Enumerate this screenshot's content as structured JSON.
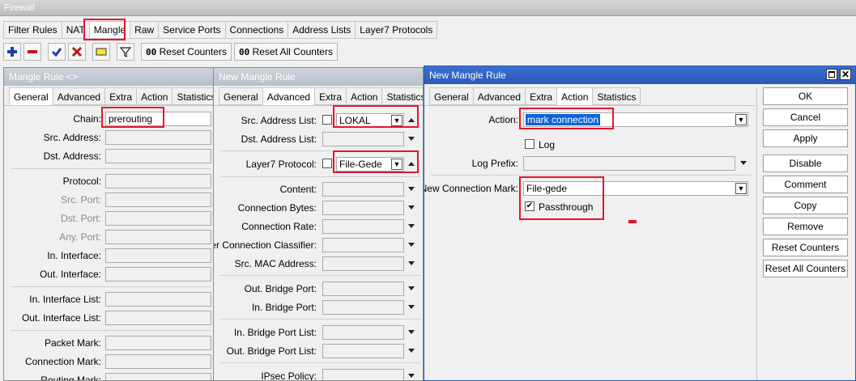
{
  "firewall": {
    "title": "Firewall",
    "tabs": [
      "Filter Rules",
      "NAT",
      "Mangle",
      "Raw",
      "Service Ports",
      "Connections",
      "Address Lists",
      "Layer7 Protocols"
    ],
    "toolbar": {
      "add_icon": "plus-icon",
      "remove_icon": "minus-icon",
      "enable_icon": "check-icon",
      "disable_icon": "x-icon",
      "comment_icon": "note-icon",
      "filter_icon": "filter-icon",
      "reset_counters": "Reset Counters",
      "reset_all_counters": "Reset All Counters",
      "counter_prefix": "00"
    }
  },
  "rule1": {
    "title": "Mangle Rule <>",
    "tabs": [
      "General",
      "Advanced",
      "Extra",
      "Action",
      "Statistics"
    ],
    "labels": {
      "chain": "Chain:",
      "src_address": "Src. Address:",
      "dst_address": "Dst. Address:",
      "protocol": "Protocol:",
      "src_port": "Src. Port:",
      "dst_port": "Dst. Port:",
      "any_port": "Any. Port:",
      "in_interface": "In. Interface:",
      "out_interface": "Out. Interface:",
      "in_interface_list": "In. Interface List:",
      "out_interface_list": "Out. Interface List:",
      "packet_mark": "Packet Mark:",
      "connection_mark": "Connection Mark:",
      "routing_mark": "Routing Mark:"
    },
    "chain_value": "prerouting"
  },
  "rule2": {
    "title": "New Mangle Rule",
    "tabs": [
      "General",
      "Advanced",
      "Extra",
      "Action",
      "Statistics"
    ],
    "labels": {
      "src_address_list": "Src. Address List:",
      "dst_address_list": "Dst. Address List:",
      "layer7_protocol": "Layer7 Protocol:",
      "content": "Content:",
      "connection_bytes": "Connection Bytes:",
      "connection_rate": "Connection Rate:",
      "per_connection_classifier": "Per Connection Classifier:",
      "src_mac_address": "Src. MAC Address:",
      "out_bridge_port": "Out. Bridge Port:",
      "in_bridge_port": "In. Bridge Port:",
      "in_bridge_port_list": "In. Bridge Port List:",
      "out_bridge_port_list": "Out. Bridge Port List:",
      "ipsec_policy": "IPsec Policy:"
    },
    "src_address_list_value": "LOKAL",
    "layer7_protocol_value": "File-Gede"
  },
  "rule3": {
    "title": "New Mangle Rule",
    "tabs": [
      "General",
      "Advanced",
      "Extra",
      "Action",
      "Statistics"
    ],
    "labels": {
      "action": "Action:",
      "log": "Log",
      "log_prefix": "Log Prefix:",
      "new_connection_mark": "New Connection Mark:",
      "passthrough": "Passthrough"
    },
    "action_value": "mark connection",
    "new_connection_mark_value": "File-gede",
    "log_checked": false,
    "passthrough_checked": true,
    "buttons": [
      "OK",
      "Cancel",
      "Apply",
      "Disable",
      "Comment",
      "Copy",
      "Remove",
      "Reset Counters",
      "Reset All Counters"
    ]
  },
  "colors": {
    "highlight": "#e8132d",
    "selection": "#0a64d6",
    "title_active": "#2a5ab8"
  }
}
